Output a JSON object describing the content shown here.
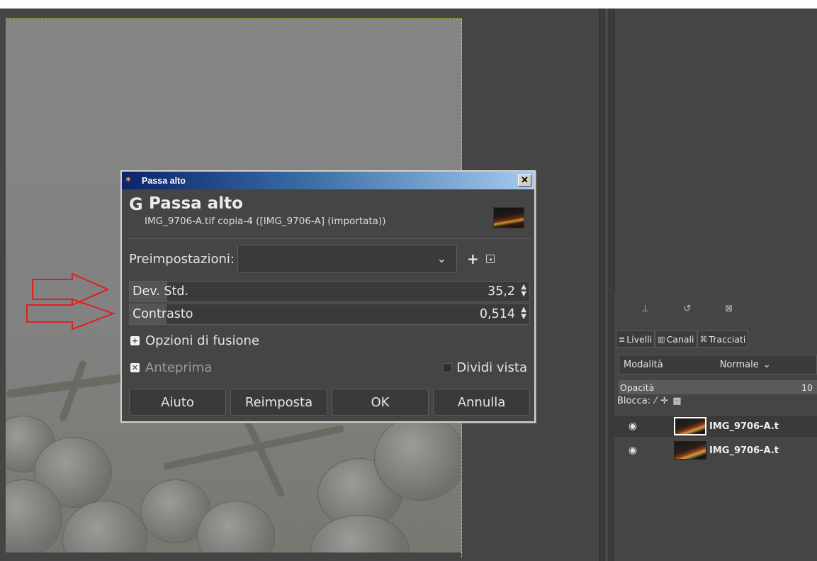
{
  "dialog": {
    "window_title": "Passa alto",
    "heading": "Passa alto",
    "subtitle": "IMG_9706-A.tif copia-4 ([IMG_9706-A] (importata))",
    "presets_label": "Preimpostazioni:",
    "presets_value": "",
    "params": [
      {
        "label": "Dev. Std.",
        "value": "35,2"
      },
      {
        "label": "Contrasto",
        "value": "0,514"
      }
    ],
    "blend_options": "Opzioni di fusione",
    "preview_label": "Anteprima",
    "preview_checked": true,
    "split_view_label": "Dividi vista",
    "split_view_checked": false,
    "buttons": {
      "help": "Aiuto",
      "reset": "Reimposta",
      "ok": "OK",
      "cancel": "Annulla"
    }
  },
  "dock": {
    "tabs": [
      {
        "icon": "layers-icon",
        "label": "Livelli"
      },
      {
        "icon": "channels-icon",
        "label": "Canali"
      },
      {
        "icon": "paths-icon",
        "label": "Tracciati"
      }
    ],
    "mode_label": "Modalità",
    "mode_value": "Normale",
    "opacity_label": "Opacità",
    "opacity_value": "10",
    "lock_label": "Blocca:",
    "layers": [
      {
        "name": "IMG_9706-A.t",
        "selected": true
      },
      {
        "name": "IMG_9706-A.t",
        "selected": false
      }
    ]
  },
  "colors": {
    "annotation_arrow": "#e02020",
    "titlebar_start": "#0a246a",
    "titlebar_end": "#a6caf0"
  }
}
